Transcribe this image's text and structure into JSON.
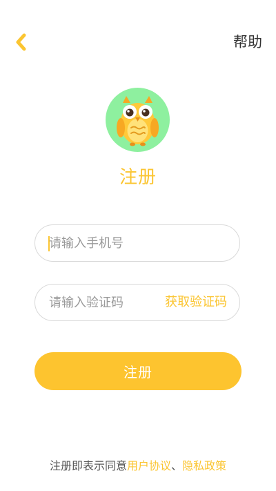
{
  "header": {
    "back_icon": "chevron-left-icon",
    "help_label": "帮助"
  },
  "logo": {
    "icon": "owl-icon",
    "background_color": "#8ef09f",
    "owl_color": "#ffc93a"
  },
  "title": "注册",
  "form": {
    "phone_placeholder": "请输入手机号",
    "code_placeholder": "请输入验证码",
    "get_code_label": "获取验证码",
    "submit_label": "注册"
  },
  "agreement": {
    "prefix": "注册即表示同意",
    "user_agreement": "用户协议",
    "separator": "、",
    "privacy_policy": "隐私政策"
  },
  "colors": {
    "accent": "#fbc531",
    "button": "#fdc42f",
    "text": "#333333",
    "placeholder": "#999999",
    "border": "#d9d9d9"
  }
}
